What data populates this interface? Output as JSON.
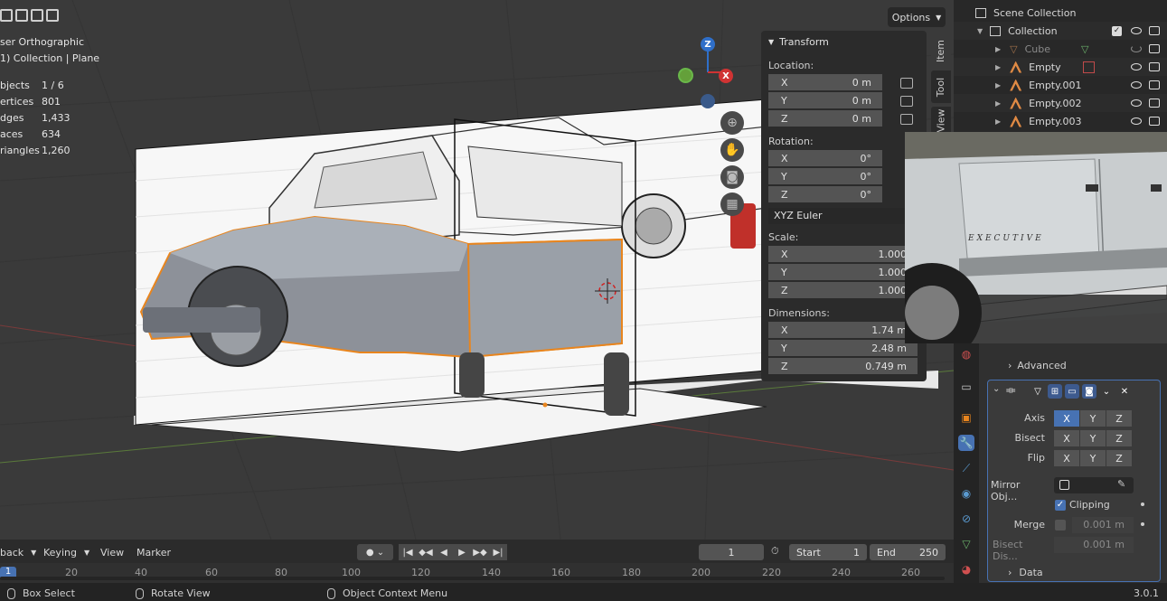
{
  "viewport": {
    "view_name": "ser Orthographic",
    "collection_line": "1) Collection | Plane",
    "stats": [
      {
        "key": "bjects",
        "value": "1 / 6"
      },
      {
        "key": "ertices",
        "value": "801"
      },
      {
        "key": "dges",
        "value": "1,433"
      },
      {
        "key": "aces",
        "value": "634"
      },
      {
        "key": "riangles",
        "value": "1,260"
      }
    ],
    "options_label": "Options",
    "gizmo": {
      "z": "Z",
      "x": "X"
    }
  },
  "transform_panel": {
    "title": "Transform",
    "location_label": "Location:",
    "location": [
      {
        "axis": "X",
        "value": "0 m"
      },
      {
        "axis": "Y",
        "value": "0 m"
      },
      {
        "axis": "Z",
        "value": "0 m"
      }
    ],
    "rotation_label": "Rotation:",
    "rotation": [
      {
        "axis": "X",
        "value": "0°"
      },
      {
        "axis": "Y",
        "value": "0°"
      },
      {
        "axis": "Z",
        "value": "0°"
      }
    ],
    "rotation_mode": "XYZ Euler",
    "scale_label": "Scale:",
    "scale": [
      {
        "axis": "X",
        "value": "1.000"
      },
      {
        "axis": "Y",
        "value": "1.000"
      },
      {
        "axis": "Z",
        "value": "1.000"
      }
    ],
    "dimensions_label": "Dimensions:",
    "dimensions": [
      {
        "axis": "X",
        "value": "1.74 m"
      },
      {
        "axis": "Y",
        "value": "2.48 m"
      },
      {
        "axis": "Z",
        "value": "0.749 m"
      }
    ]
  },
  "side_tabs": {
    "item": "Item",
    "tool": "Tool",
    "view": "View"
  },
  "outliner": {
    "scene_collection": "Scene Collection",
    "collection": "Collection",
    "items": [
      "Cube",
      "Empty",
      "Empty.001",
      "Empty.002",
      "Empty.003"
    ]
  },
  "reference_photo": {
    "badge_text": "EXECUTIVE"
  },
  "properties": {
    "advanced_label": "Advanced",
    "axis_label": "Axis",
    "bisect_label": "Bisect",
    "flip_label": "Flip",
    "axes": [
      "X",
      "Y",
      "Z"
    ],
    "mirror_object_label": "Mirror Obj...",
    "clipping_label": "Clipping",
    "merge_label": "Merge",
    "merge_value": "0.001 m",
    "bisect_distance_label": "Bisect Dis...",
    "bisect_distance_value": "0.001 m",
    "data_label": "Data"
  },
  "timeline": {
    "playback_label": "back",
    "keying_label": "Keying",
    "view_label": "View",
    "marker_label": "Marker",
    "current_frame": "1",
    "start_label": "Start",
    "start_value": "1",
    "end_label": "End",
    "end_value": "250",
    "current_frame_marker": "1",
    "ruler_ticks": [
      "20",
      "40",
      "60",
      "80",
      "100",
      "120",
      "140",
      "160",
      "180",
      "200",
      "220",
      "240",
      "260"
    ]
  },
  "statusbar": {
    "box_select": "Box Select",
    "rotate_view": "Rotate View",
    "context_menu": "Object Context Menu",
    "version": "3.0.1"
  },
  "colors": {
    "accent": "#4772b3",
    "selection_orange": "#e8851e",
    "panel_bg": "#2b2b2b"
  }
}
